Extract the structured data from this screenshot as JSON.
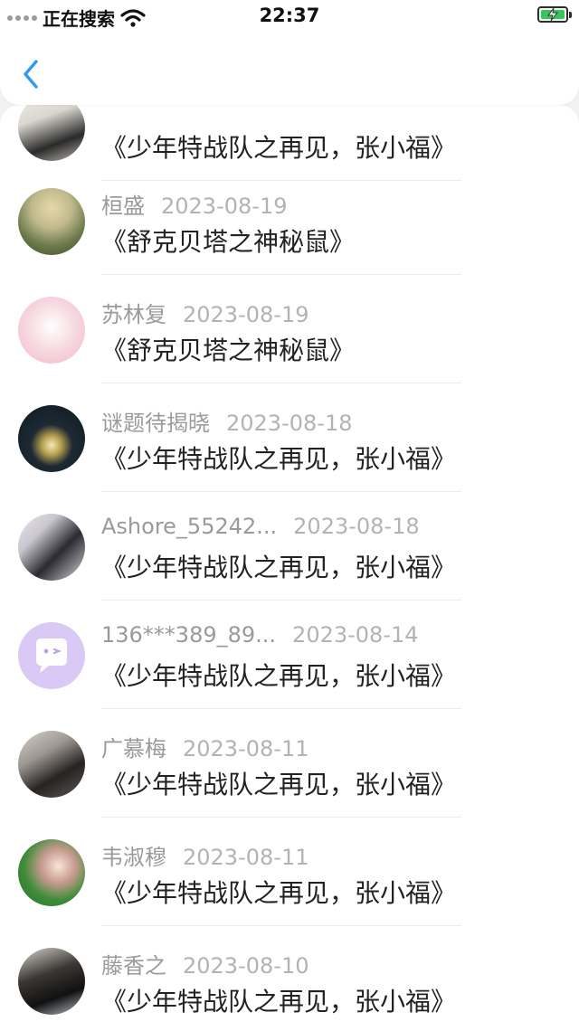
{
  "status_bar": {
    "carrier": "正在搜索",
    "time": "22:37"
  },
  "nav": {
    "back_icon": "chevron-left-icon"
  },
  "items": [
    {
      "name": "",
      "date": "",
      "title": "《少年特战队之再见，张小福》"
    },
    {
      "name": "桓盛",
      "date": "2023-08-19",
      "title": "《舒克贝塔之神秘鼠》"
    },
    {
      "name": "苏林复",
      "date": "2023-08-19",
      "title": "《舒克贝塔之神秘鼠》"
    },
    {
      "name": "谜题待揭晓",
      "date": "2023-08-18",
      "title": "《少年特战队之再见，张小福》"
    },
    {
      "name": "Ashore_55242...",
      "date": "2023-08-18",
      "title": "《少年特战队之再见，张小福》"
    },
    {
      "name": "136***389_89...",
      "date": "2023-08-14",
      "title": "《少年特战队之再见，张小福》"
    },
    {
      "name": "广慕梅",
      "date": "2023-08-11",
      "title": "《少年特战队之再见，张小福》"
    },
    {
      "name": "韦淑穆",
      "date": "2023-08-11",
      "title": "《少年特战队之再见，张小福》"
    },
    {
      "name": "藤香之",
      "date": "2023-08-10",
      "title": "《少年特战队之再见，张小福》"
    }
  ],
  "colors": {
    "accent": "#2e9bf0",
    "battery": "#34c759"
  }
}
